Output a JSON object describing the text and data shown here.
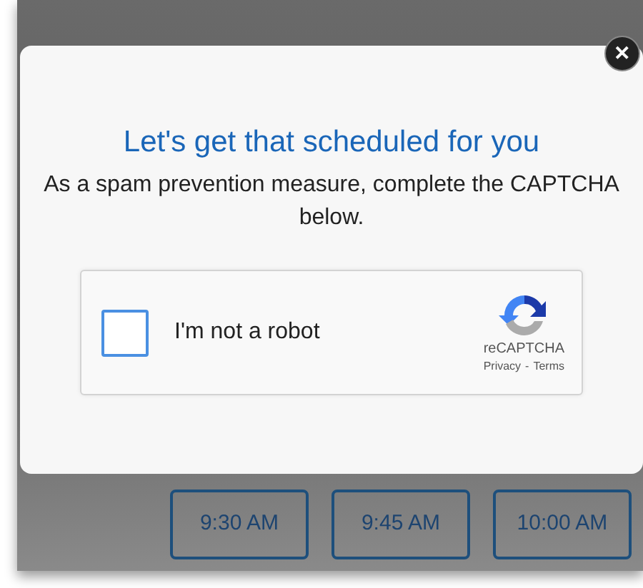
{
  "dialog": {
    "title": "Let's get that scheduled for you",
    "message": "As a spam prevention measure, complete the CAPTCHA below.",
    "close_label": "✕"
  },
  "captcha": {
    "label": "I'm not a robot",
    "checked": false,
    "brand": "reCAPTCHA",
    "links": [
      "Privacy",
      "Terms"
    ],
    "separator": "-"
  },
  "time_slots": [
    {
      "label": "9:30 AM"
    },
    {
      "label": "9:45 AM"
    },
    {
      "label": "10:00 AM"
    }
  ]
}
